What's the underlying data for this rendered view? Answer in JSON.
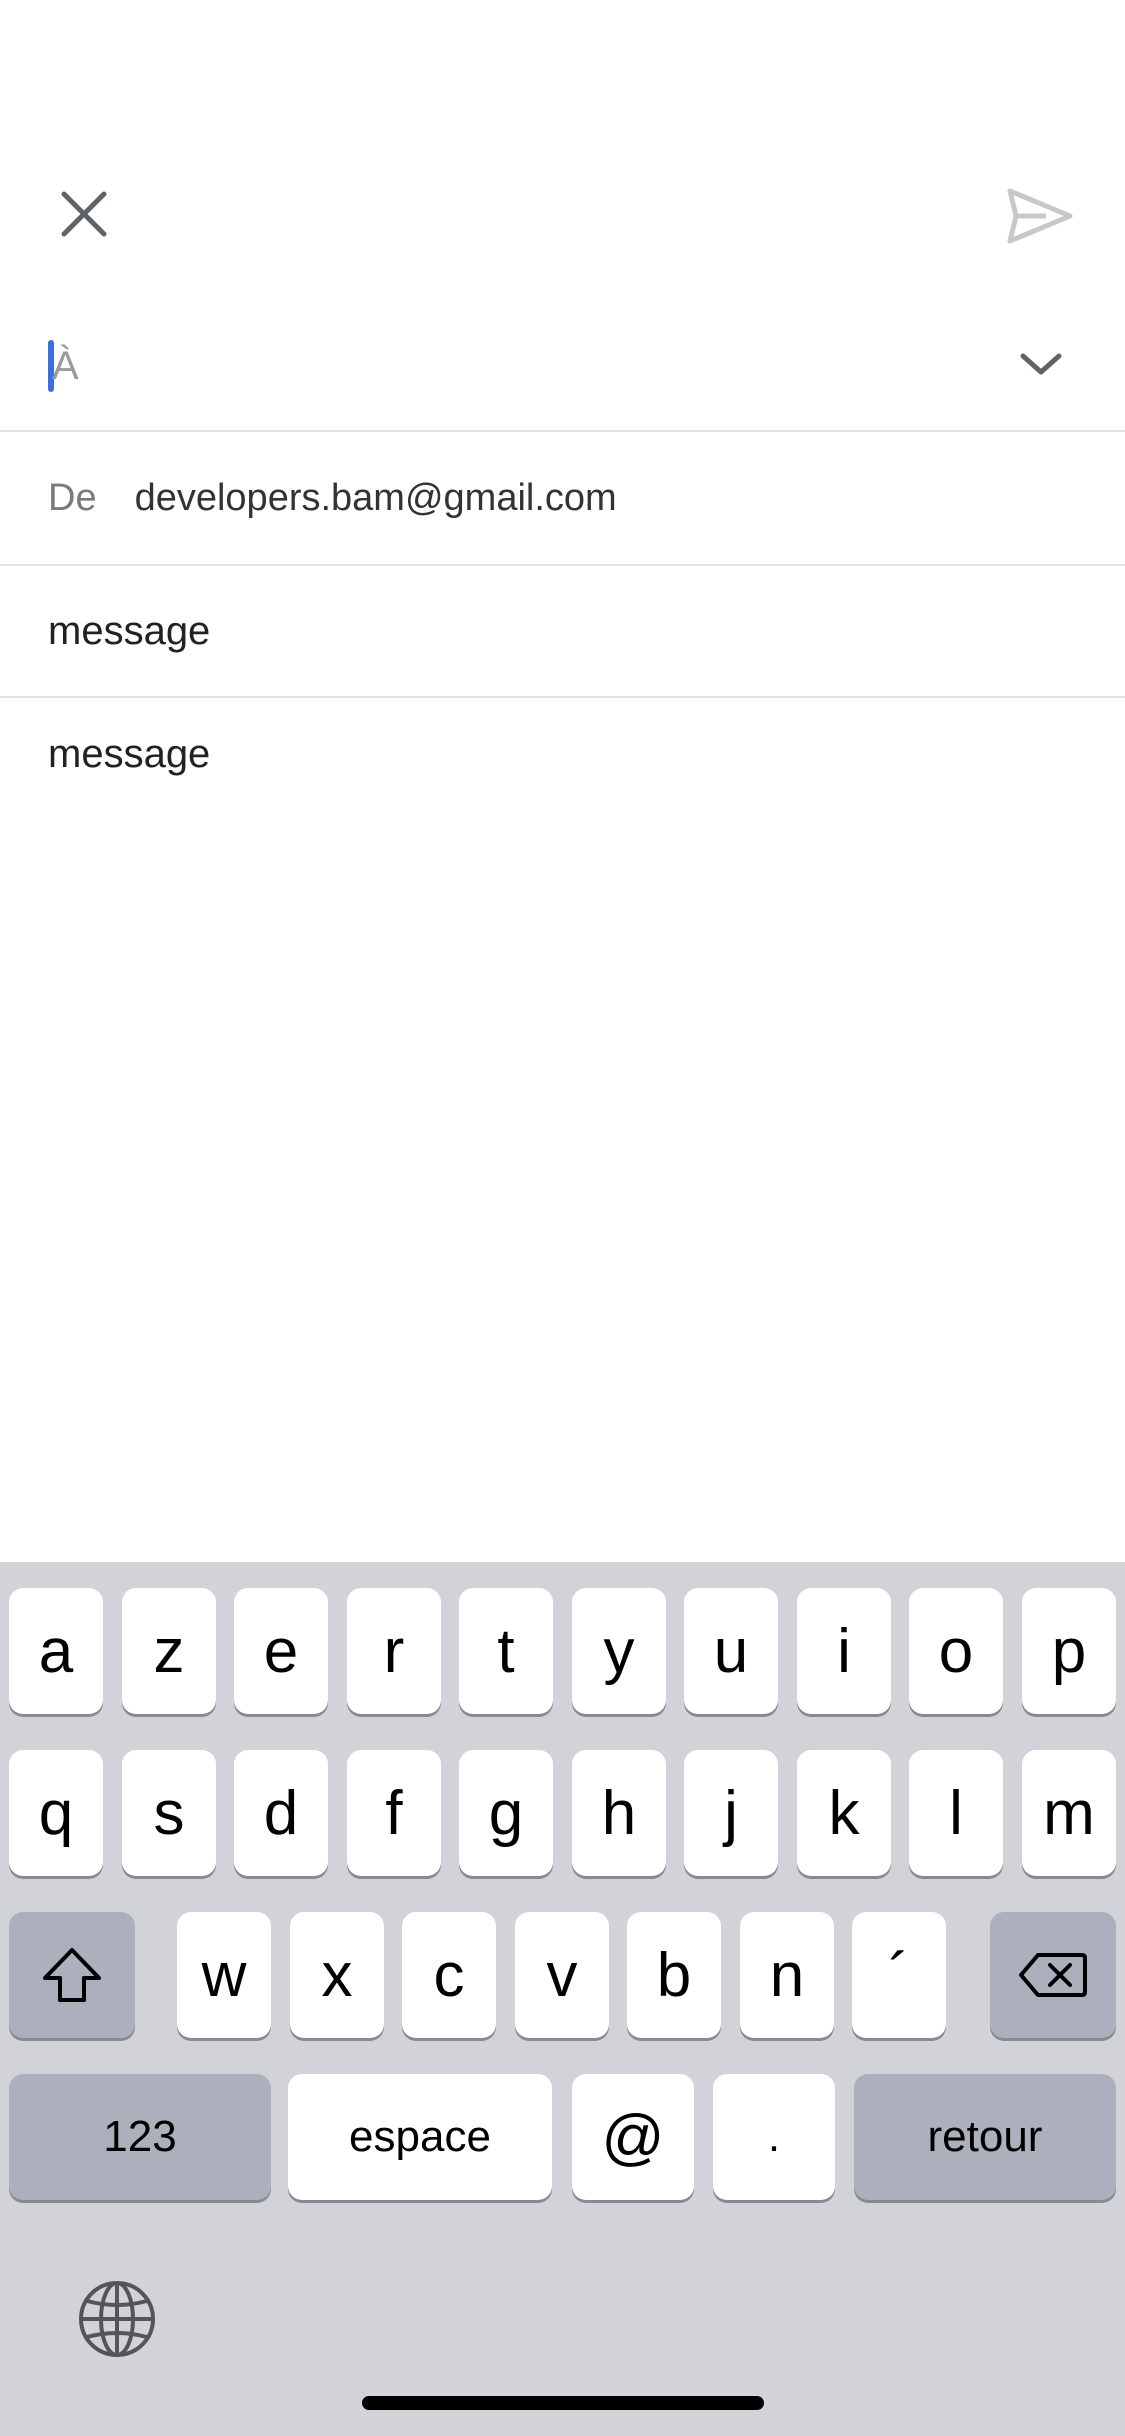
{
  "compose": {
    "to_label": "À",
    "from_label": "De",
    "from_value": "developers.bam@gmail.com",
    "subject_value": "message",
    "body_value": "message"
  },
  "keyboard": {
    "row1": [
      "a",
      "z",
      "e",
      "r",
      "t",
      "y",
      "u",
      "i",
      "o",
      "p"
    ],
    "row2": [
      "q",
      "s",
      "d",
      "f",
      "g",
      "h",
      "j",
      "k",
      "l",
      "m"
    ],
    "row3": [
      "w",
      "x",
      "c",
      "v",
      "b",
      "n",
      "´"
    ],
    "numbers_label": "123",
    "space_label": "espace",
    "at_label": "@",
    "dot_label": ".",
    "return_label": "retour"
  },
  "icons": {
    "close": "close-icon",
    "send": "send-icon",
    "expand": "chevron-down-icon",
    "shift": "shift-icon",
    "delete": "backspace-icon",
    "globe": "globe-icon"
  },
  "colors": {
    "caret": "#3b6fe0",
    "keyboard_bg": "#d1d3d9",
    "key_dark": "#abb0bc",
    "divider": "#e3e3e3"
  }
}
